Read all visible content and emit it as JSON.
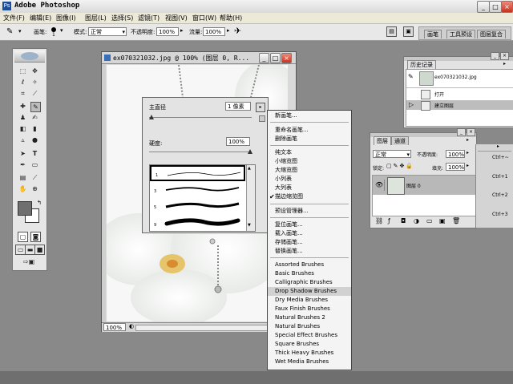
{
  "app": {
    "title": "Adobe Photoshop"
  },
  "menu": [
    "文件(F)",
    "编辑(E)",
    "图像(I)",
    "图层(L)",
    "选择(S)",
    "滤镜(T)",
    "视图(V)",
    "窗口(W)",
    "帮助(H)"
  ],
  "options": {
    "brush_label": "画笔:",
    "brush_size": "1",
    "mode_label": "模式:",
    "mode_value": "正常",
    "opacity_label": "不透明度:",
    "opacity_value": "100%",
    "flow_label": "流量:",
    "flow_value": "100%"
  },
  "palette_well": [
    "画笔",
    "工具预设",
    "图层复合"
  ],
  "document": {
    "title": "ex070321032.jpg @ 100% (图层 0, R...",
    "zoom": "100%"
  },
  "brush_picker": {
    "diameter_label": "主直径",
    "diameter_value": "1 像素",
    "hardness_label": "硬度:",
    "hardness_value": "100%",
    "sizes": [
      "1",
      "3",
      "5",
      "9"
    ]
  },
  "context_menu": {
    "group1": [
      "新画笔..."
    ],
    "group2": [
      "重命名画笔...",
      "删除画笔"
    ],
    "group3": [
      "纯文本",
      "小缩览图",
      "大缩览图",
      "小列表",
      "大列表",
      "描边缩览图"
    ],
    "checked_item": "描边缩览图",
    "group4": [
      "预设管理器..."
    ],
    "group5": [
      "复位画笔...",
      "载入画笔...",
      "存储画笔...",
      "替换画笔..."
    ],
    "group6": [
      "Assorted Brushes",
      "Basic Brushes",
      "Calligraphic Brushes",
      "Drop Shadow Brushes",
      "Dry Media Brushes",
      "Faux Finish Brushes",
      "Natural Brushes 2",
      "Natural Brushes",
      "Special Effect Brushes",
      "Square Brushes",
      "Thick Heavy Brushes",
      "Wet Media Brushes"
    ],
    "highlighted": "Drop Shadow Brushes"
  },
  "history": {
    "tab": "历史记录",
    "snapshot": "ex070321032.jpg",
    "items": [
      "打开",
      "建立图层"
    ]
  },
  "layers": {
    "tabs": [
      "图层",
      "通道"
    ],
    "blend_mode": "正常",
    "opacity_label": "不透明度:",
    "opacity_value": "100%",
    "lock_label": "锁定:",
    "fill_label": "填充:",
    "fill_value": "100%",
    "layer_name": "图层 0"
  },
  "actions_shortcuts": [
    "Ctrl+~",
    "Ctrl+1",
    "Ctrl+2",
    "Ctrl+3"
  ]
}
